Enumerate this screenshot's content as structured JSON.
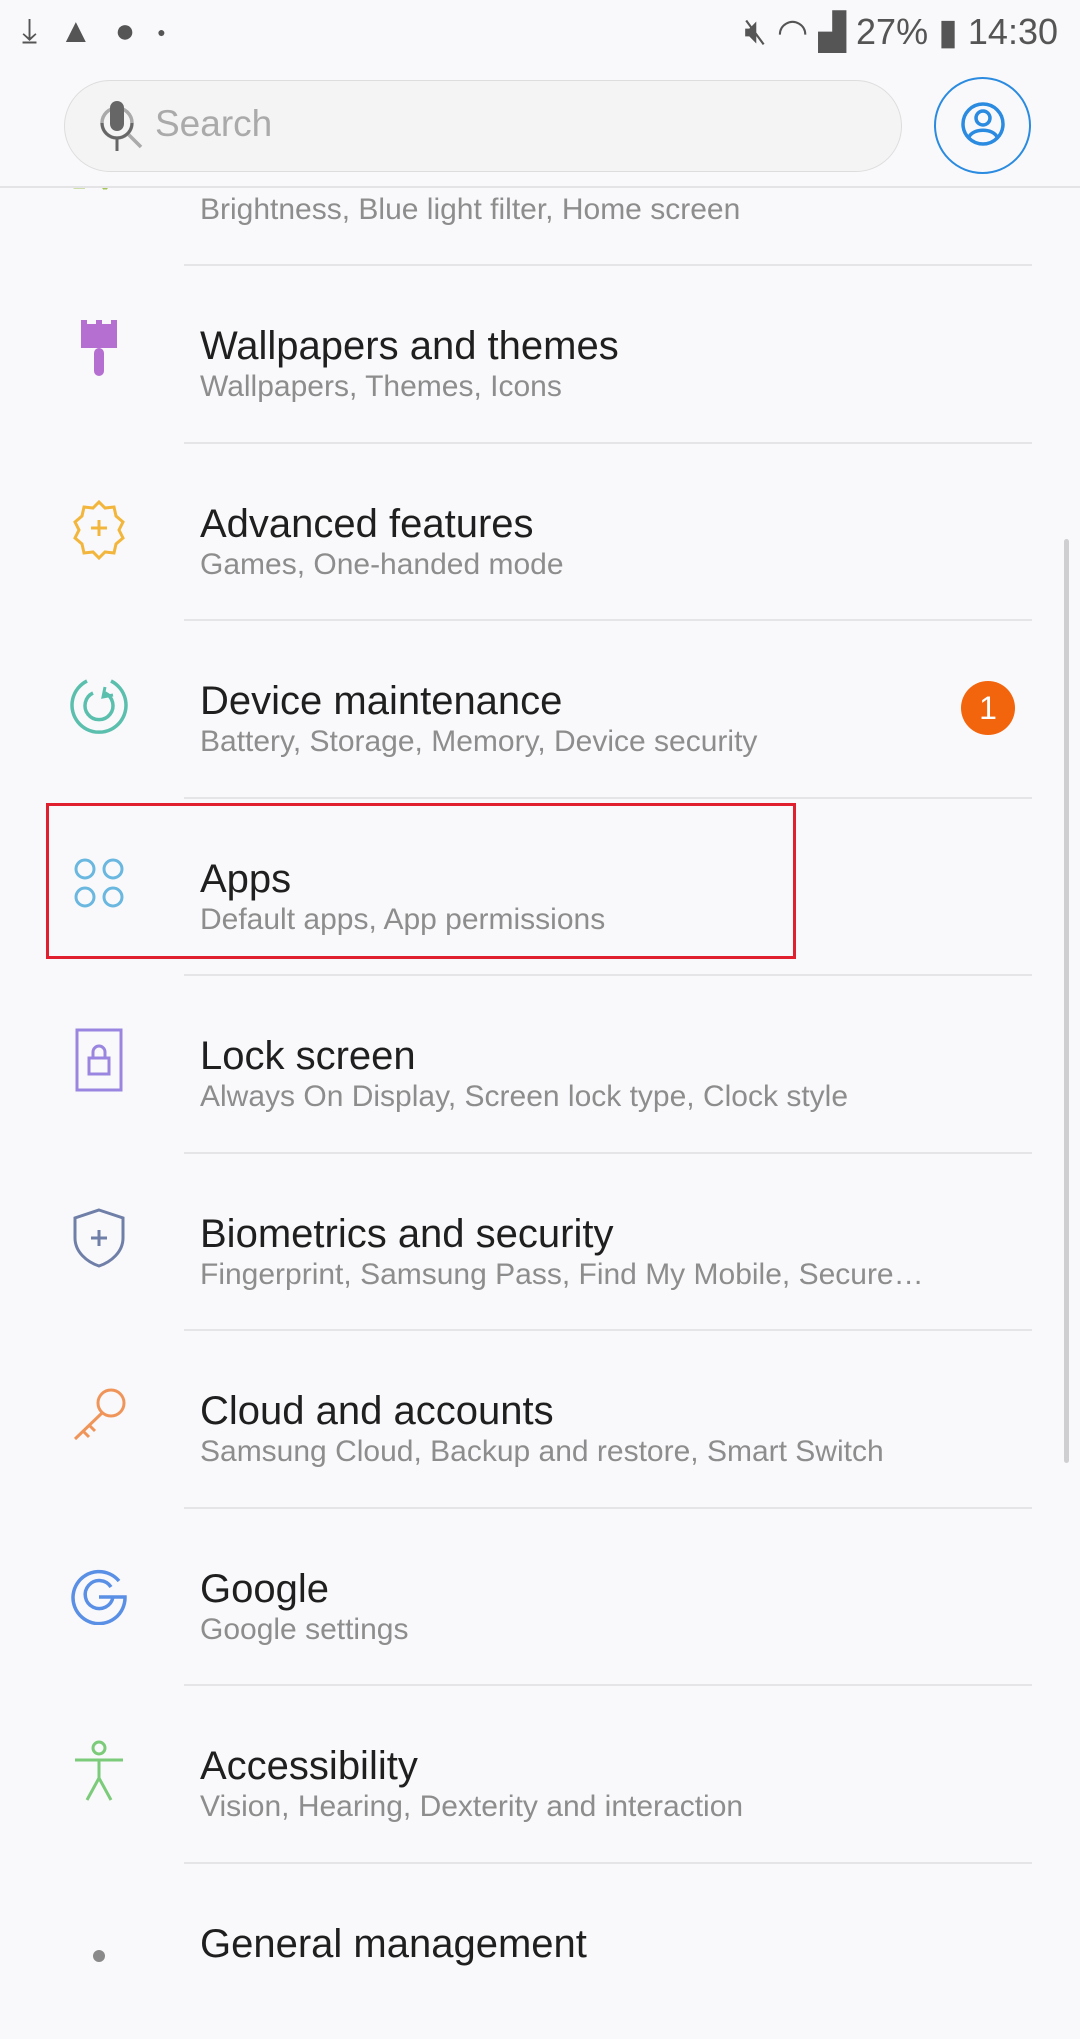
{
  "status_bar": {
    "battery": "27%",
    "time": "14:30",
    "icons": [
      "download-icon",
      "warning-icon",
      "alert-icon",
      "dot-icon",
      "mute-icon",
      "wifi-icon",
      "signal-icon",
      "battery-charging-icon"
    ]
  },
  "search": {
    "placeholder": "Search",
    "mic": "mic-icon",
    "profile": "profile-icon"
  },
  "partial_top": {
    "subtitle": "Brightness, Blue light filter, Home screen"
  },
  "items": [
    {
      "title": "Wallpapers and themes",
      "subtitle": "Wallpapers, Themes, Icons",
      "icon": "paint-brush-icon",
      "color": "#b46fd1"
    },
    {
      "title": "Advanced features",
      "subtitle": "Games, One-handed mode",
      "icon": "gear-plus-icon",
      "color": "#f2b63c"
    },
    {
      "title": "Device maintenance",
      "subtitle": "Battery, Storage, Memory, Device security",
      "icon": "refresh-circle-icon",
      "color": "#5bbfae",
      "badge": "1"
    },
    {
      "title": "Apps",
      "subtitle": "Default apps, App permissions",
      "icon": "apps-grid-icon",
      "color": "#6ab7e0",
      "highlighted": true
    },
    {
      "title": "Lock screen",
      "subtitle": "Always On Display, Screen lock type, Clock style",
      "icon": "lock-icon",
      "color": "#9a86e0"
    },
    {
      "title": "Biometrics and security",
      "subtitle": "Fingerprint, Samsung Pass, Find My Mobile, Secure…",
      "icon": "shield-icon",
      "color": "#6f7fa8"
    },
    {
      "title": "Cloud and accounts",
      "subtitle": "Samsung Cloud, Backup and restore, Smart Switch",
      "icon": "key-icon",
      "color": "#f0955a"
    },
    {
      "title": "Google",
      "subtitle": "Google settings",
      "icon": "google-icon",
      "color": "#5a8fe6"
    },
    {
      "title": "Accessibility",
      "subtitle": "Vision, Hearing, Dexterity and interaction",
      "icon": "accessibility-icon",
      "color": "#7ccb7a"
    },
    {
      "title": "General management",
      "subtitle": "",
      "icon": "sliders-icon",
      "color": "#8a8a8a"
    }
  ],
  "colors": {
    "highlight": "#e0202f",
    "badge": "#f2650d",
    "accent": "#2b8be0"
  }
}
